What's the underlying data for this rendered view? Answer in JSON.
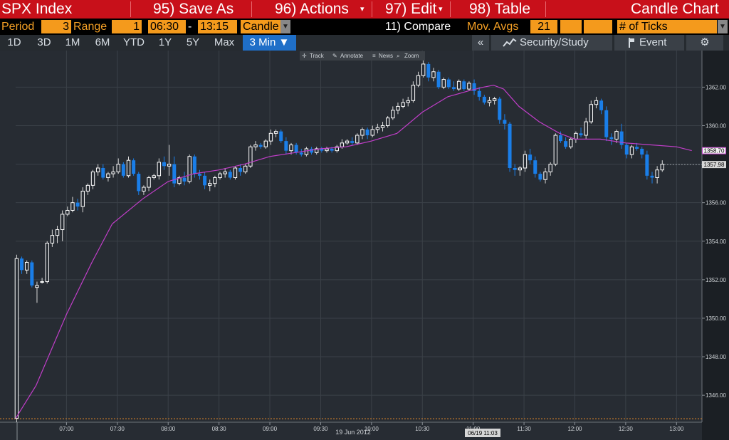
{
  "toolbar": {
    "title": "SPX Index",
    "save_as": "95) Save As",
    "actions": "96) Actions",
    "edit": "97) Edit",
    "table": "98) Table",
    "chart_type": "Candle Chart"
  },
  "params": {
    "period_label": "Period",
    "period_value": "3",
    "range_label": "Range",
    "range_value": "1",
    "start_time": "06:30",
    "dash": "-",
    "end_time": "13:15",
    "style_value": "Candle",
    "compare": "11) Compare",
    "mov_avgs_label": "Mov. Avgs",
    "mov_avgs_value": "21",
    "ticks_label": "# of Ticks"
  },
  "tabs": {
    "items": [
      "1D",
      "3D",
      "1M",
      "6M",
      "YTD",
      "1Y",
      "5Y",
      "Max"
    ],
    "active": "3 Min ▼",
    "collapse": "«",
    "security_study": "Security/Study",
    "event": "Event",
    "gear": "⚙"
  },
  "chart_tools": {
    "track": "Track",
    "annotate": "Annotate",
    "news": "News",
    "zoom": "Zoom"
  },
  "colors": {
    "background": "#272c33",
    "up_candle": "#ffffff",
    "down_candle": "#1a7ee8",
    "moving_average": "#c13ec9",
    "toolbar_red": "#c8101a",
    "field_orange": "#f49a1c",
    "last_price_box": "#d7d7d7",
    "ma_price_box": "#c13ec9"
  },
  "chart_data": {
    "type": "candlestick",
    "date_label": "19 Jun 2012",
    "crosshair_label": "06/19 11:03",
    "ylim": [
      1344.6,
      1363.9
    ],
    "yticks": [
      1346,
      1348,
      1350,
      1352,
      1354,
      1356,
      1358,
      1360,
      1362
    ],
    "ytick_labels": [
      "1346.00",
      "1348.00",
      "1350.00",
      "1352.00",
      "1354.00",
      "1356.00",
      "1358.00",
      "1360.00",
      "1362.00"
    ],
    "xticks": [
      "07:00",
      "07:30",
      "08:00",
      "08:30",
      "09:00",
      "09:30",
      "10:00",
      "10:30",
      "11:00",
      "11:30",
      "12:00",
      "12:30",
      "13:00"
    ],
    "last_price": 1357.98,
    "last_price_label": "1357.98",
    "ma_value": 1358.7,
    "ma_value_label": "1358.70",
    "prev_close": 1344.78,
    "candles": [
      [
        "06:30",
        1344.8,
        1353.3,
        1344.6,
        1353.1
      ],
      [
        "06:33",
        1353.1,
        1353.2,
        1352.3,
        1352.5
      ],
      [
        "06:36",
        1352.5,
        1353.0,
        1352.3,
        1352.9
      ],
      [
        "06:39",
        1352.9,
        1353.0,
        1351.6,
        1351.7
      ],
      [
        "06:42",
        1351.6,
        1351.9,
        1350.8,
        1351.7
      ],
      [
        "06:45",
        1351.9,
        1352.1,
        1351.8,
        1351.9
      ],
      [
        "06:48",
        1351.9,
        1354.0,
        1351.8,
        1353.9
      ],
      [
        "06:51",
        1353.9,
        1354.6,
        1353.7,
        1354.3
      ],
      [
        "06:54",
        1354.3,
        1354.8,
        1353.9,
        1354.6
      ],
      [
        "06:57",
        1354.6,
        1355.6,
        1354.0,
        1355.4
      ],
      [
        "07:00",
        1355.4,
        1355.8,
        1355.3,
        1355.6
      ],
      [
        "07:03",
        1355.6,
        1356.3,
        1355.5,
        1356.0
      ],
      [
        "07:06",
        1356.0,
        1356.2,
        1355.6,
        1355.8
      ],
      [
        "07:09",
        1355.8,
        1356.8,
        1355.5,
        1356.6
      ],
      [
        "07:12",
        1356.6,
        1357.0,
        1356.4,
        1356.9
      ],
      [
        "07:15",
        1356.9,
        1357.7,
        1356.7,
        1357.6
      ],
      [
        "07:18",
        1357.6,
        1358.0,
        1357.4,
        1357.8
      ],
      [
        "07:21",
        1357.8,
        1358.0,
        1357.2,
        1357.3
      ],
      [
        "07:24",
        1357.3,
        1357.6,
        1357.1,
        1357.5
      ],
      [
        "07:27",
        1357.5,
        1357.9,
        1357.3,
        1357.6
      ],
      [
        "07:30",
        1357.6,
        1358.3,
        1357.5,
        1358.0
      ],
      [
        "07:33",
        1358.0,
        1358.1,
        1357.3,
        1357.4
      ],
      [
        "07:36",
        1357.4,
        1358.4,
        1357.3,
        1358.2
      ],
      [
        "07:39",
        1358.2,
        1358.3,
        1357.4,
        1357.5
      ],
      [
        "07:42",
        1357.5,
        1357.6,
        1356.4,
        1356.6
      ],
      [
        "07:45",
        1356.6,
        1356.9,
        1356.4,
        1356.8
      ],
      [
        "07:48",
        1356.8,
        1357.4,
        1356.6,
        1357.3
      ],
      [
        "07:51",
        1357.3,
        1357.5,
        1357.2,
        1357.4
      ],
      [
        "07:54",
        1357.4,
        1358.3,
        1357.2,
        1358.1
      ],
      [
        "07:57",
        1358.1,
        1358.4,
        1357.7,
        1357.9
      ],
      [
        "08:00",
        1357.9,
        1359.0,
        1357.4,
        1358.0
      ],
      [
        "08:03",
        1358.0,
        1358.4,
        1356.8,
        1357.0
      ],
      [
        "08:06",
        1357.0,
        1357.4,
        1356.9,
        1357.3
      ],
      [
        "08:09",
        1357.3,
        1357.6,
        1356.9,
        1357.1
      ],
      [
        "08:12",
        1357.1,
        1358.5,
        1357.0,
        1358.4
      ],
      [
        "08:15",
        1358.4,
        1358.5,
        1357.3,
        1357.5
      ],
      [
        "08:18",
        1357.5,
        1357.7,
        1357.2,
        1357.4
      ],
      [
        "08:21",
        1357.4,
        1357.6,
        1356.7,
        1356.9
      ],
      [
        "08:24",
        1356.9,
        1357.2,
        1356.6,
        1357.0
      ],
      [
        "08:27",
        1357.0,
        1357.4,
        1356.8,
        1357.3
      ],
      [
        "08:30",
        1357.3,
        1357.6,
        1357.2,
        1357.5
      ],
      [
        "08:33",
        1357.5,
        1357.8,
        1357.3,
        1357.6
      ],
      [
        "08:36",
        1357.6,
        1357.7,
        1357.2,
        1357.3
      ],
      [
        "08:39",
        1357.3,
        1357.9,
        1357.2,
        1357.8
      ],
      [
        "08:42",
        1357.8,
        1358.0,
        1357.4,
        1357.6
      ],
      [
        "08:45",
        1357.6,
        1358.0,
        1357.5,
        1357.9
      ],
      [
        "08:48",
        1357.9,
        1359.0,
        1357.8,
        1358.9
      ],
      [
        "08:51",
        1358.9,
        1359.2,
        1358.7,
        1359.0
      ],
      [
        "08:54",
        1359.0,
        1359.1,
        1358.8,
        1358.9
      ],
      [
        "08:57",
        1358.9,
        1359.3,
        1358.8,
        1359.2
      ],
      [
        "09:00",
        1359.2,
        1359.8,
        1359.0,
        1359.6
      ],
      [
        "09:03",
        1359.6,
        1359.8,
        1359.4,
        1359.7
      ],
      [
        "09:06",
        1359.7,
        1359.8,
        1359.1,
        1359.2
      ],
      [
        "09:09",
        1359.2,
        1359.4,
        1358.5,
        1358.7
      ],
      [
        "09:12",
        1358.7,
        1359.1,
        1358.5,
        1359.0
      ],
      [
        "09:15",
        1359.0,
        1359.1,
        1358.5,
        1358.6
      ],
      [
        "09:18",
        1358.6,
        1358.8,
        1358.4,
        1358.5
      ],
      [
        "09:21",
        1358.5,
        1358.9,
        1358.4,
        1358.8
      ],
      [
        "09:24",
        1358.8,
        1358.9,
        1358.5,
        1358.6
      ],
      [
        "09:27",
        1358.6,
        1358.9,
        1358.5,
        1358.8
      ],
      [
        "09:30",
        1358.8,
        1358.9,
        1358.6,
        1358.7
      ],
      [
        "09:33",
        1358.7,
        1358.9,
        1358.6,
        1358.8
      ],
      [
        "09:36",
        1358.8,
        1358.9,
        1358.6,
        1358.7
      ],
      [
        "09:39",
        1358.7,
        1359.0,
        1358.6,
        1358.9
      ],
      [
        "09:42",
        1358.9,
        1359.3,
        1358.8,
        1359.1
      ],
      [
        "09:45",
        1359.1,
        1359.3,
        1359.0,
        1359.2
      ],
      [
        "09:48",
        1359.2,
        1359.4,
        1359.0,
        1359.1
      ],
      [
        "09:51",
        1359.1,
        1359.6,
        1359.0,
        1359.5
      ],
      [
        "09:54",
        1359.5,
        1359.9,
        1359.3,
        1359.8
      ],
      [
        "09:57",
        1359.8,
        1359.9,
        1359.3,
        1359.5
      ],
      [
        "10:00",
        1359.5,
        1360.0,
        1359.4,
        1359.8
      ],
      [
        "10:03",
        1359.8,
        1360.1,
        1359.6,
        1359.9
      ],
      [
        "10:06",
        1359.9,
        1360.2,
        1359.7,
        1360.0
      ],
      [
        "10:09",
        1360.0,
        1360.5,
        1359.9,
        1360.4
      ],
      [
        "10:12",
        1360.4,
        1361.0,
        1360.3,
        1360.8
      ],
      [
        "10:15",
        1360.8,
        1361.2,
        1360.6,
        1361.0
      ],
      [
        "10:18",
        1361.0,
        1361.4,
        1360.9,
        1361.2
      ],
      [
        "10:21",
        1361.2,
        1361.5,
        1361.0,
        1361.3
      ],
      [
        "10:24",
        1361.3,
        1362.3,
        1361.2,
        1362.1
      ],
      [
        "10:27",
        1362.1,
        1362.8,
        1362.0,
        1362.6
      ],
      [
        "10:30",
        1362.6,
        1363.4,
        1362.5,
        1363.2
      ],
      [
        "10:33",
        1363.2,
        1363.3,
        1362.3,
        1362.5
      ],
      [
        "10:36",
        1362.5,
        1363.0,
        1362.3,
        1362.8
      ],
      [
        "10:39",
        1362.8,
        1362.9,
        1361.9,
        1362.0
      ],
      [
        "10:42",
        1362.0,
        1362.5,
        1361.9,
        1362.4
      ],
      [
        "10:45",
        1362.4,
        1362.5,
        1361.9,
        1362.0
      ],
      [
        "10:48",
        1362.0,
        1362.3,
        1361.8,
        1361.9
      ],
      [
        "10:51",
        1361.9,
        1362.4,
        1361.8,
        1362.3
      ],
      [
        "10:54",
        1362.3,
        1362.4,
        1361.8,
        1361.9
      ],
      [
        "10:57",
        1361.9,
        1362.3,
        1361.8,
        1362.2
      ],
      [
        "11:00",
        1362.2,
        1362.4,
        1361.6,
        1361.8
      ],
      [
        "11:03",
        1361.8,
        1362.0,
        1361.3,
        1361.5
      ],
      [
        "11:06",
        1361.5,
        1361.6,
        1361.1,
        1361.2
      ],
      [
        "11:09",
        1361.2,
        1361.5,
        1361.0,
        1361.3
      ],
      [
        "11:12",
        1361.3,
        1361.5,
        1361.1,
        1361.4
      ],
      [
        "11:15",
        1361.4,
        1361.5,
        1360.1,
        1360.3
      ],
      [
        "11:18",
        1360.3,
        1360.6,
        1359.8,
        1360.1
      ],
      [
        "11:21",
        1360.1,
        1360.2,
        1357.6,
        1357.8
      ],
      [
        "11:24",
        1357.8,
        1358.0,
        1357.4,
        1357.7
      ],
      [
        "11:27",
        1357.7,
        1357.9,
        1357.4,
        1357.8
      ],
      [
        "11:30",
        1357.8,
        1358.7,
        1357.6,
        1358.5
      ],
      [
        "11:33",
        1358.5,
        1358.8,
        1358.0,
        1358.2
      ],
      [
        "11:36",
        1358.2,
        1358.4,
        1357.3,
        1357.5
      ],
      [
        "11:39",
        1357.5,
        1357.6,
        1357.1,
        1357.2
      ],
      [
        "11:42",
        1357.2,
        1357.8,
        1357.0,
        1357.6
      ],
      [
        "11:45",
        1357.6,
        1358.1,
        1357.4,
        1358.0
      ],
      [
        "11:48",
        1358.0,
        1359.6,
        1357.9,
        1359.5
      ],
      [
        "11:51",
        1359.5,
        1359.7,
        1359.1,
        1359.2
      ],
      [
        "11:54",
        1359.2,
        1359.4,
        1358.8,
        1358.9
      ],
      [
        "11:57",
        1358.9,
        1359.4,
        1358.8,
        1359.3
      ],
      [
        "12:00",
        1359.3,
        1359.7,
        1359.1,
        1359.6
      ],
      [
        "12:03",
        1359.6,
        1359.9,
        1359.4,
        1359.5
      ],
      [
        "12:06",
        1359.5,
        1360.4,
        1359.3,
        1360.2
      ],
      [
        "12:09",
        1360.2,
        1361.3,
        1360.1,
        1361.1
      ],
      [
        "12:12",
        1361.1,
        1361.5,
        1360.9,
        1361.3
      ],
      [
        "12:15",
        1361.3,
        1361.4,
        1360.6,
        1360.8
      ],
      [
        "12:18",
        1360.8,
        1361.0,
        1359.2,
        1359.4
      ],
      [
        "12:21",
        1359.4,
        1359.6,
        1359.0,
        1359.3
      ],
      [
        "12:24",
        1359.3,
        1359.8,
        1359.1,
        1359.7
      ],
      [
        "12:27",
        1359.7,
        1360.1,
        1358.8,
        1359.0
      ],
      [
        "12:30",
        1359.0,
        1359.1,
        1358.3,
        1358.5
      ],
      [
        "12:33",
        1358.5,
        1359.0,
        1358.3,
        1358.9
      ],
      [
        "12:36",
        1358.9,
        1359.1,
        1358.7,
        1358.8
      ],
      [
        "12:39",
        1358.8,
        1358.9,
        1358.3,
        1358.5
      ],
      [
        "12:42",
        1358.5,
        1358.7,
        1357.2,
        1357.4
      ],
      [
        "12:45",
        1357.4,
        1357.6,
        1357.0,
        1357.3
      ],
      [
        "12:48",
        1357.3,
        1357.9,
        1357.0,
        1357.7
      ],
      [
        "12:51",
        1357.7,
        1358.2,
        1357.6,
        1358.0
      ]
    ],
    "moving_average": [
      [
        "06:30",
        1344.8
      ],
      [
        "06:42",
        1346.5
      ],
      [
        "07:00",
        1350.2
      ],
      [
        "07:15",
        1352.9
      ],
      [
        "07:27",
        1354.9
      ],
      [
        "07:45",
        1356.2
      ],
      [
        "08:00",
        1357.1
      ],
      [
        "08:15",
        1357.5
      ],
      [
        "08:30",
        1357.7
      ],
      [
        "08:45",
        1358.0
      ],
      [
        "09:00",
        1358.4
      ],
      [
        "09:15",
        1358.6
      ],
      [
        "09:30",
        1358.8
      ],
      [
        "09:45",
        1358.9
      ],
      [
        "10:00",
        1359.2
      ],
      [
        "10:15",
        1359.6
      ],
      [
        "10:30",
        1360.7
      ],
      [
        "10:45",
        1361.5
      ],
      [
        "10:57",
        1361.8
      ],
      [
        "11:06",
        1362.0
      ],
      [
        "11:12",
        1362.1
      ],
      [
        "11:18",
        1361.9
      ],
      [
        "11:27",
        1361.0
      ],
      [
        "11:39",
        1360.2
      ],
      [
        "11:51",
        1359.6
      ],
      [
        "12:00",
        1359.3
      ],
      [
        "12:15",
        1359.3
      ],
      [
        "12:30",
        1359.1
      ],
      [
        "12:45",
        1359.0
      ],
      [
        "13:00",
        1358.9
      ],
      [
        "13:09",
        1358.7
      ]
    ]
  }
}
